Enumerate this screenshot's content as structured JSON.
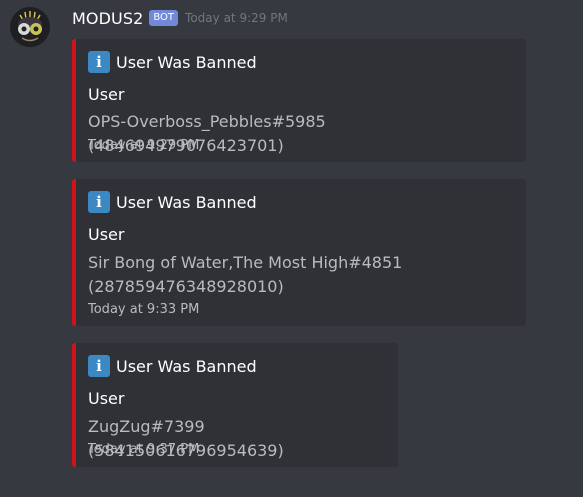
{
  "message": {
    "username": "MODUS2",
    "bot_tag": "BOT",
    "timestamp": "Today at 9:29 PM"
  },
  "embed_color": "#d0121b",
  "icon": "information-icon",
  "icon_glyph": "i",
  "embeds": [
    {
      "title": "User Was Banned",
      "field_name": "User",
      "field_value_line1": "OPS-Overboss_Pebbles#5985 (484694979076423701)",
      "field_value_line2": "",
      "footer": "Today at 9:29 PM"
    },
    {
      "title": "User Was Banned",
      "field_name": "User",
      "field_value_line1": "Sir Bong of Water,The Most High#4851",
      "field_value_line2": "(287859476348928010)",
      "footer": "Today at 9:33 PM"
    },
    {
      "title": "User Was Banned",
      "field_name": "User",
      "field_value_line1": "ZugZug#7399 (584150616796954639)",
      "field_value_line2": "",
      "footer": "Today at 9:37 PM"
    }
  ]
}
